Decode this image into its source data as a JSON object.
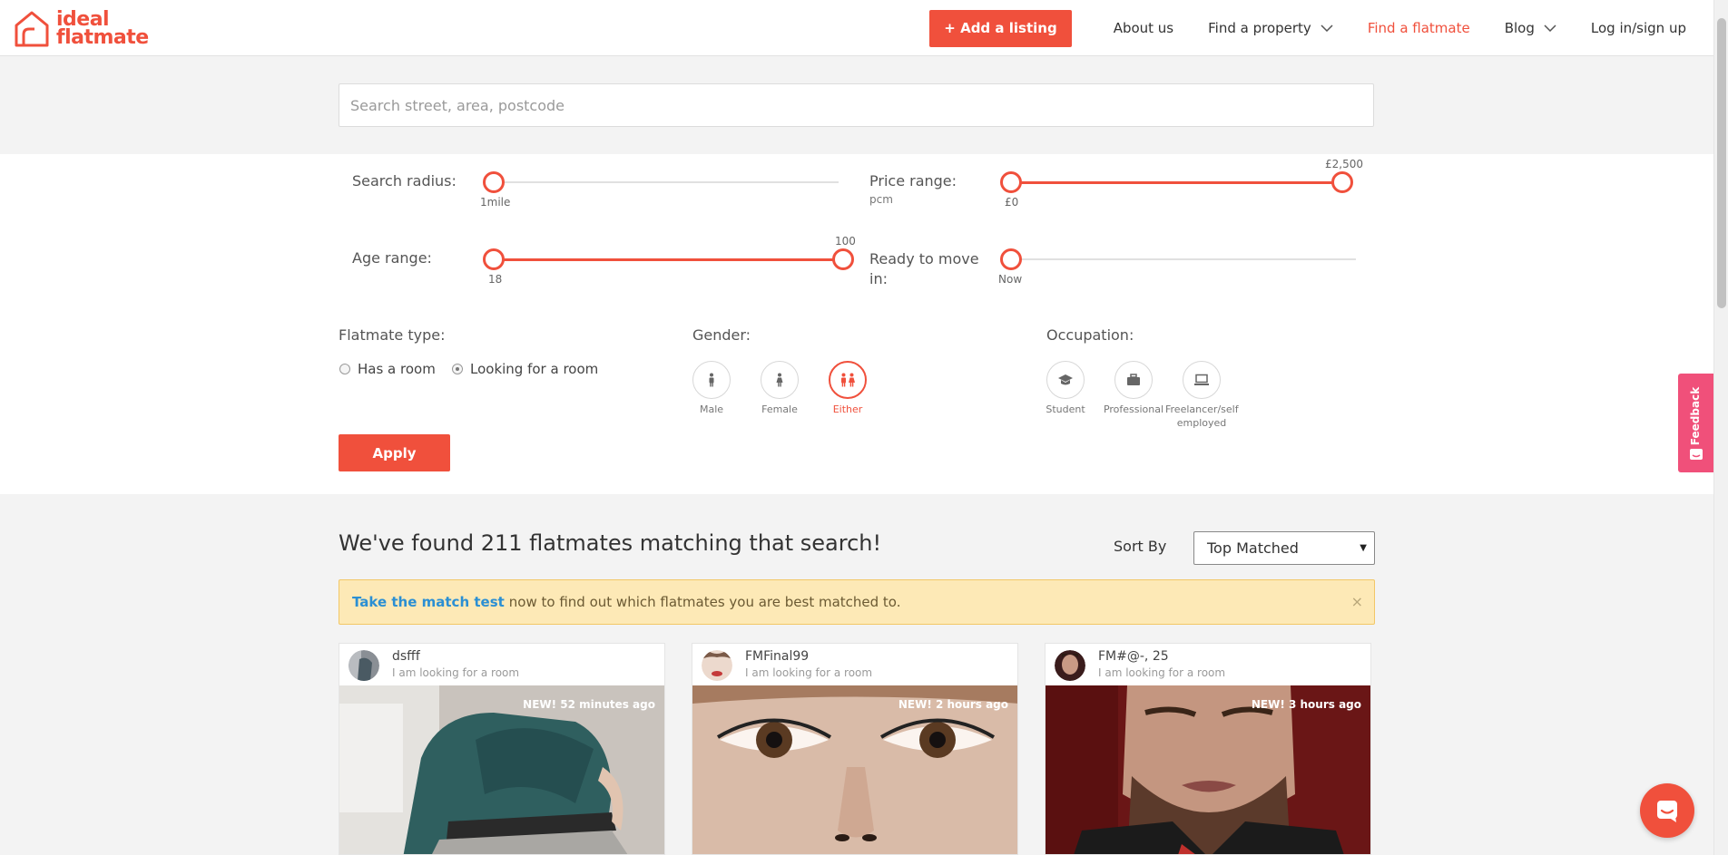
{
  "brand": {
    "line1": "ideal",
    "line2": "flatmate",
    "accent": "#f0503c"
  },
  "nav": {
    "add_listing": "+ Add a listing",
    "about": "About us",
    "find_property": "Find a property",
    "find_flatmate": "Find a flatmate",
    "blog": "Blog",
    "login": "Log in/sign up"
  },
  "search": {
    "placeholder": "Search street, area, postcode"
  },
  "filters": {
    "radius": {
      "label": "Search radius:",
      "value_label": "1mile",
      "value": 1
    },
    "price": {
      "label": "Price range:",
      "sub": "pcm",
      "min_label": "£0",
      "max_label": "£2,500",
      "min": 0,
      "max": 2500
    },
    "age": {
      "label": "Age range:",
      "min_label": "18",
      "max_label": "100",
      "min": 18,
      "max": 100
    },
    "move_in": {
      "label_line1": "Ready to move",
      "label_line2": "in:",
      "value_label": "Now"
    },
    "flatmate_type": {
      "label": "Flatmate type:",
      "options": [
        "Has a room",
        "Looking for a room"
      ],
      "selected": "Looking for a room"
    },
    "gender": {
      "label": "Gender:",
      "options": [
        "Male",
        "Female",
        "Either"
      ],
      "selected": "Either"
    },
    "occupation": {
      "label": "Occupation:",
      "options": [
        "Student",
        "Professional",
        "Freelancer/self employed"
      ]
    },
    "apply": "Apply"
  },
  "results": {
    "title": "We've found 211 flatmates matching that search!",
    "sort_label": "Sort By",
    "sort_value": "Top Matched"
  },
  "alert": {
    "link": "Take the match test",
    "text": "now to find out which flatmates you are best matched to.",
    "close": "×"
  },
  "cards": [
    {
      "name": "dsfff",
      "sub": "I am looking for a room",
      "badge": "NEW! 52 minutes ago"
    },
    {
      "name": "FMFinal99",
      "sub": "I am looking for a room",
      "badge": "NEW! 2 hours ago"
    },
    {
      "name": "FM#@-, 25",
      "sub": "I am looking for a room",
      "badge": "NEW! 3 hours ago"
    }
  ],
  "feedback": "Feedback"
}
